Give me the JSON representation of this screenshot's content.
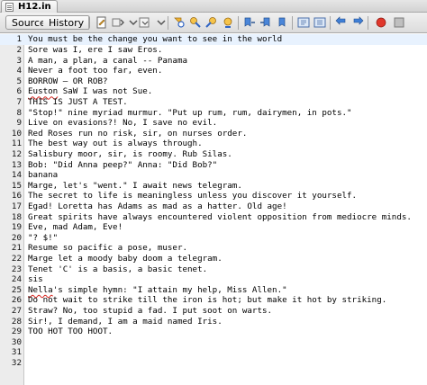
{
  "window": {
    "tab_title": "H12.in"
  },
  "toolbar": {
    "source_label": "Source",
    "history_label": "History",
    "icons": [
      "last-edit-icon",
      "back-icon",
      "forward-icon",
      "find-selection-icon",
      "find-previous-icon",
      "find-next-icon",
      "toggle-highlight-icon",
      "toggle-rect-selection-icon",
      "bookmark-previous-icon",
      "bookmark-next-icon",
      "toggle-bookmark-icon",
      "shift-left-icon",
      "shift-right-icon",
      "start-macro-icon",
      "stop-macro-icon"
    ]
  },
  "editor": {
    "current_line": 1,
    "lines": [
      {
        "n": "1",
        "text": "You must be the change you want to see in the world"
      },
      {
        "n": "2",
        "text": "Sore was I, ere I saw Eros."
      },
      {
        "n": "3",
        "text": "A man, a plan, a canal -- Panama"
      },
      {
        "n": "4",
        "text": "Never a foot too far, even."
      },
      {
        "n": "5",
        "text": "BORROW — OR ROB?"
      },
      {
        "n": "6",
        "text": "Euston SaW I was not Sue.",
        "squig": "Euston"
      },
      {
        "n": "7",
        "text": "THIS IS JUST A TEST."
      },
      {
        "n": "8",
        "text": "\"Stop!\" nine myriad murmur. \"Put up rum, rum, dairymen, in pots.\""
      },
      {
        "n": "9",
        "text": "Live on evasions?! No, I save no evil."
      },
      {
        "n": "10",
        "text": "Red Roses run no risk, sir, on nurses order."
      },
      {
        "n": "11",
        "text": "The best way out is always through."
      },
      {
        "n": "12",
        "text": "Salisbury moor, sir, is roomy. Rub Silas."
      },
      {
        "n": "13",
        "text": "Bob: \"Did Anna peep?\" Anna: \"Did Bob?\""
      },
      {
        "n": "14",
        "text": "banana"
      },
      {
        "n": "15",
        "text": "Marge, let's \"went.\" I await news telegram."
      },
      {
        "n": "16",
        "text": "The secret to life is meaningless unless you discover it yourself."
      },
      {
        "n": "17",
        "text": "Egad! Loretta has Adams as mad as a hatter. Old age!"
      },
      {
        "n": "18",
        "text": "Great spirits have always encountered violent opposition from mediocre minds."
      },
      {
        "n": "19",
        "text": "Eve, mad Adam, Eve!"
      },
      {
        "n": "20",
        "text": "\"? $!\""
      },
      {
        "n": "21",
        "text": "Resume so pacific a pose, muser."
      },
      {
        "n": "22",
        "text": "Marge let a moody baby doom a telegram."
      },
      {
        "n": "23",
        "text": "Tenet 'C' is a basis, a basic tenet."
      },
      {
        "n": "24",
        "text": "sis"
      },
      {
        "n": "25",
        "text": "Nella's simple hymn: \"I attain my help, Miss Allen.\"",
        "squig": "Nella"
      },
      {
        "n": "26",
        "text": "Do not wait to strike till the iron is hot; but make it hot by striking."
      },
      {
        "n": "27",
        "text": "Straw? No, too stupid a fad. I put soot on warts."
      },
      {
        "n": "28",
        "text": "Sir!, I demand, I am a maid named Iris."
      },
      {
        "n": "29",
        "text": "TOO HOT TOO HOOT."
      },
      {
        "n": "30",
        "text": ""
      },
      {
        "n": "31",
        "text": ""
      },
      {
        "n": "32",
        "text": ""
      }
    ]
  }
}
